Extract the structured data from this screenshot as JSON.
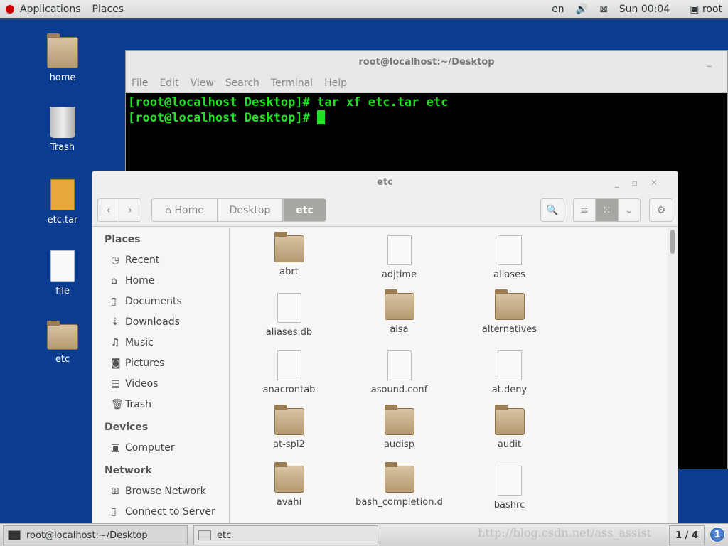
{
  "topbar": {
    "applications": "Applications",
    "places": "Places",
    "lang": "en",
    "clock": "Sun 00:04",
    "user": "root"
  },
  "desktop": [
    {
      "label": "home",
      "icon": "home-folder-icon"
    },
    {
      "label": "Trash",
      "icon": "trash-icon"
    },
    {
      "label": "etc.tar",
      "icon": "archive-icon"
    },
    {
      "label": "file",
      "icon": "file-icon"
    },
    {
      "label": "etc",
      "icon": "folder-icon"
    }
  ],
  "terminal": {
    "title": "root@localhost:~/Desktop",
    "menu": [
      "File",
      "Edit",
      "View",
      "Search",
      "Terminal",
      "Help"
    ],
    "line1": "[root@localhost Desktop]# tar xf etc.tar etc",
    "line2": "[root@localhost Desktop]# "
  },
  "filemanager": {
    "title": "etc",
    "breadcrumb": [
      "Home",
      "Desktop",
      "etc"
    ],
    "sidebar": {
      "places_header": "Places",
      "places": [
        "Recent",
        "Home",
        "Documents",
        "Downloads",
        "Music",
        "Pictures",
        "Videos",
        "Trash"
      ],
      "devices_header": "Devices",
      "devices": [
        "Computer"
      ],
      "network_header": "Network",
      "network": [
        "Browse Network",
        "Connect to Server"
      ]
    },
    "files": [
      {
        "name": "abrt",
        "type": "folder"
      },
      {
        "name": "adjtime",
        "type": "file"
      },
      {
        "name": "aliases",
        "type": "file"
      },
      {
        "name": "aliases.db",
        "type": "file"
      },
      {
        "name": "alsa",
        "type": "folder"
      },
      {
        "name": "alternatives",
        "type": "folder"
      },
      {
        "name": "anacrontab",
        "type": "file"
      },
      {
        "name": "asound.conf",
        "type": "file"
      },
      {
        "name": "at.deny",
        "type": "file"
      },
      {
        "name": "at-spi2",
        "type": "folder"
      },
      {
        "name": "audisp",
        "type": "folder"
      },
      {
        "name": "audit",
        "type": "folder"
      },
      {
        "name": "avahi",
        "type": "folder"
      },
      {
        "name": "bash_completion.d",
        "type": "folder"
      },
      {
        "name": "bashrc",
        "type": "file"
      }
    ]
  },
  "taskbar": {
    "task1": "root@localhost:~/Desktop",
    "task2": "etc",
    "workspace": "1 / 4",
    "notifications": "1",
    "watermark": "http://blog.csdn.net/ass_assist"
  }
}
